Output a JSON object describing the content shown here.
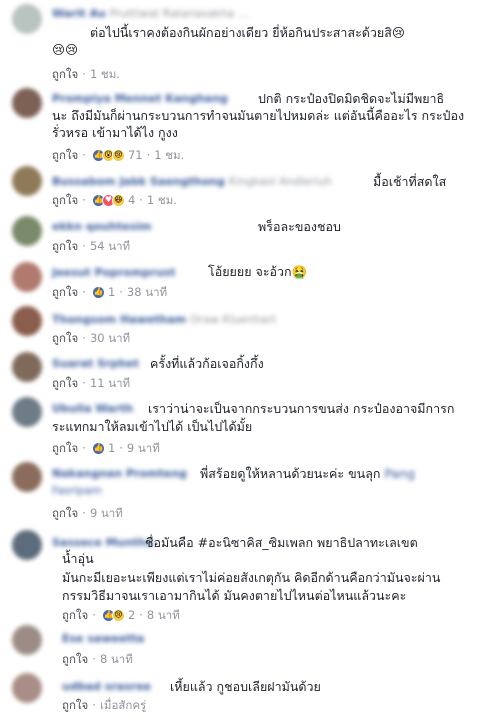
{
  "like_label": "ถูกใจ",
  "comments": [
    {
      "name": "Warit Au",
      "name_extra": "Pruttiwat Ratanasakha ...",
      "avatar_color": "#b9c3c0",
      "lines": [
        "ต่อไปนี้เราคงต้องกินผักอย่างเดียว ยี่ห้อกินประสาสะด้วยสิ😢",
        "😢😢"
      ],
      "reactions": [],
      "count": "",
      "time": "1 ชม."
    },
    {
      "name": "Prompiya Mennet Kanghang",
      "name_extra": "",
      "avatar_color": "#7d6154",
      "lines": [
        "ปกติ กระป๋องปิดมิดชิดจะไม่มีพยาธิ",
        "นะ ถึงมีมันก็ผ่านกระบวนการทำจนมันตายไปหมดล่ะ แต่อันนี้คืออะไร กระป๋อง",
        "รั่วหรอ เข้ามาได้ไง กูงง"
      ],
      "reactions": [
        "like",
        "wow",
        "sad"
      ],
      "count": "71",
      "time": "1 ชม."
    },
    {
      "name": "Bussabom Jabk Saengthong",
      "name_extra": "Kingkaol Andleriuh",
      "avatar_color": "#8e7a58",
      "lines": [
        "มื้อเช้าที่สดใส"
      ],
      "reactions": [
        "like",
        "love",
        "haha"
      ],
      "count": "4",
      "time": "1 ชม."
    },
    {
      "name": "ekkn qouhtesim",
      "name_extra": "",
      "avatar_color": "#7b8a6a",
      "lines": [
        "พร็อละของชอบ"
      ],
      "reactions": [],
      "count": "",
      "time": "54 นาที"
    },
    {
      "name": "Jeesut Popromprust",
      "name_extra": "",
      "avatar_color": "#b07a6e",
      "lines": [
        "โอ้ยยยย จะอ้วก🤮"
      ],
      "reactions": [
        "like"
      ],
      "count": "1",
      "time": "38 นาที"
    },
    {
      "name": "Thongsom Hawetham",
      "name_extra": "Oraw Kluenhart",
      "avatar_color": "#8a5d4d",
      "lines": [
        ""
      ],
      "reactions": [],
      "count": "",
      "time": "30 นาที"
    },
    {
      "name": "Suarat Srphet",
      "name_extra": "",
      "avatar_color": "#7f6a5a",
      "lines": [
        "ครั้งที่แล้วก้อเจอกิ้งกึ้ง"
      ],
      "reactions": [],
      "count": "",
      "time": "11 นาที"
    },
    {
      "name": "Ubulla Warth",
      "name_extra": "",
      "avatar_color": "#6e7c86",
      "lines": [
        "เราว่าน่าจะเป็นจากกระบวนการขนส่ง กระป๋องอาจมีการก",
        "ระแทกมาให้ลมเข้าไปได้ เป็นไปได้มั้ย"
      ],
      "reactions": [
        "like"
      ],
      "count": "1",
      "time": "9 นาที"
    },
    {
      "name": "Nakangnan Promteng",
      "name_extra": "",
      "avatar_color": "#8b6c5c",
      "lines": [
        "พี่สร้อยดูให้หลานด้วยนะค่ะ ขนลุก",
        "Fasripam"
      ],
      "reactions": [],
      "count": "",
      "time": "9 นาที"
    },
    {
      "name": "Sassece Munthu",
      "name_extra": "",
      "avatar_color": "#5d6c7c",
      "lines": [
        "ชื่อมันคือ #อะนิซาคิส_ซิมเพลก พยาธิปลาทะเลเขต",
        "น้ำอุ่น",
        "มันกะมีเยอะนะเพียงแต่เราไม่ค่อยสังเกตุกัน คิดอีกด้านคือกว่ามันจะผ่าน",
        "กรรมวิธีมาจนเราเอามากินได้ มันคงตายไปไหนต่อไหนแล้วนะคะ"
      ],
      "reactions": [
        "like",
        "sad"
      ],
      "count": "2",
      "time": "8 นาที"
    },
    {
      "name": "Ese saweetta",
      "name_extra": "",
      "avatar_color": "#9b8c86",
      "lines": [
        ""
      ],
      "reactions": [],
      "count": "",
      "time": "8 นาที"
    },
    {
      "name": "udbad srasree",
      "name_extra": "",
      "avatar_color": "#a88e86",
      "lines": [
        "เหี้ยแล้ว กูชอบเลียฝามันด้วย"
      ],
      "reactions": [],
      "count": "",
      "time": "เมื่อสักครู่"
    }
  ]
}
